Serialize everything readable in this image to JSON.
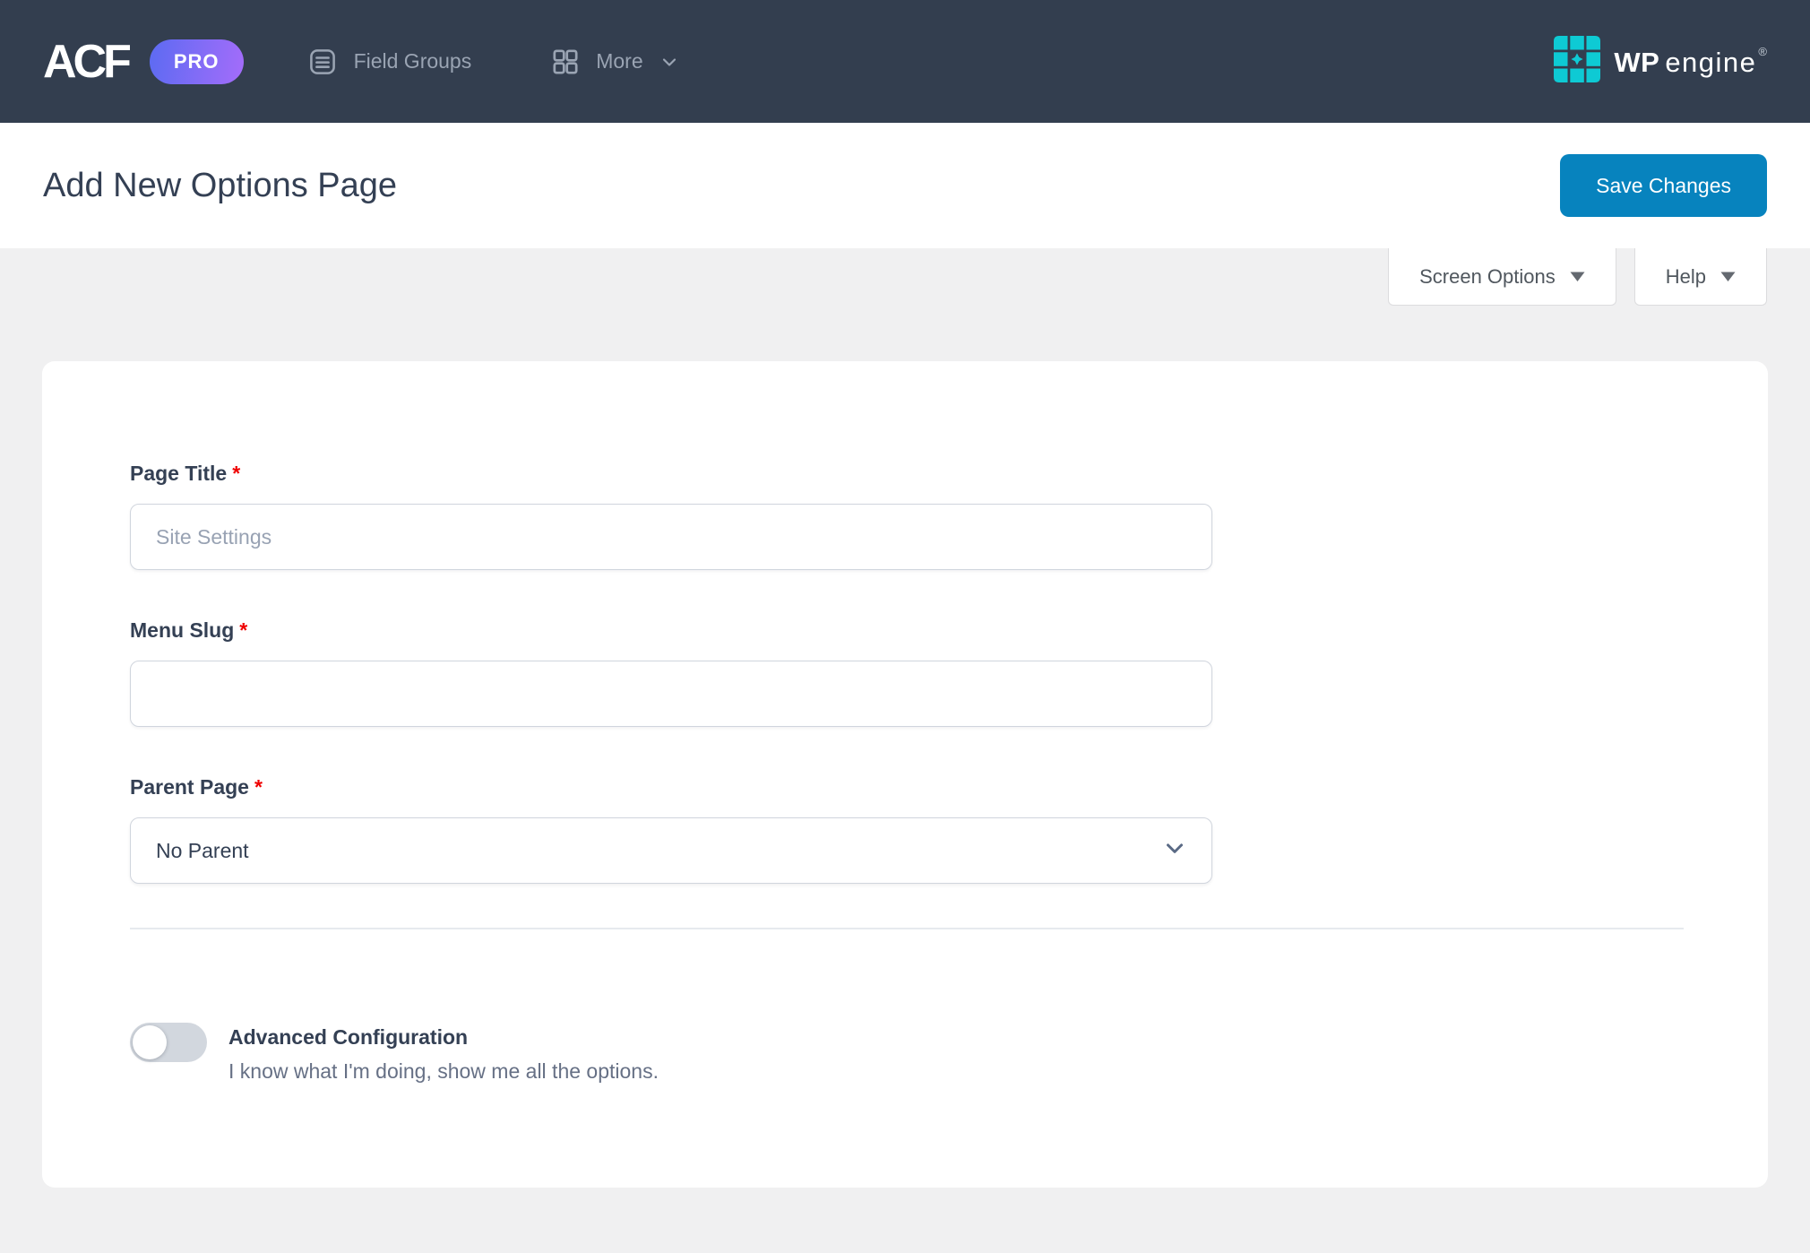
{
  "navbar": {
    "logo": "ACF",
    "pro_badge": "PRO",
    "nav_items": [
      {
        "label": "Field Groups",
        "icon": "field-groups-list-icon"
      },
      {
        "label": "More",
        "icon": "more-grid-icon"
      }
    ],
    "wpengine": {
      "wp": "WP",
      "engine": "engine",
      "mark": "®",
      "brand_color": "#0ecad4"
    }
  },
  "page_header": {
    "title": "Add New Options Page",
    "save_button": "Save Changes"
  },
  "screen_tabs": [
    {
      "label": "Screen Options",
      "icon": "triangle-down-icon"
    },
    {
      "label": "Help",
      "icon": "triangle-down-icon"
    }
  ],
  "form": {
    "page_title": {
      "label": "Page Title",
      "required_mark": "*",
      "placeholder": "Site Settings",
      "value": ""
    },
    "menu_slug": {
      "label": "Menu Slug",
      "required_mark": "*",
      "placeholder": "",
      "value": ""
    },
    "parent_page": {
      "label": "Parent Page",
      "required_mark": "*",
      "selected_option": "No Parent",
      "icon": "chevron-down-icon"
    },
    "advanced_configuration": {
      "label": "Advanced Configuration",
      "description": "I know what I'm doing, show me all the options.",
      "toggle_state": "off"
    }
  },
  "colors": {
    "navbar_bg": "#333e4f",
    "accent_blue": "#0783be",
    "pro_gradient_start": "#5c6bf2",
    "pro_gradient_end": "#a46cfa",
    "required_red": "#ef0000",
    "title_text": "#344054",
    "muted_text": "#667085",
    "page_bg": "#f0f0f1"
  }
}
